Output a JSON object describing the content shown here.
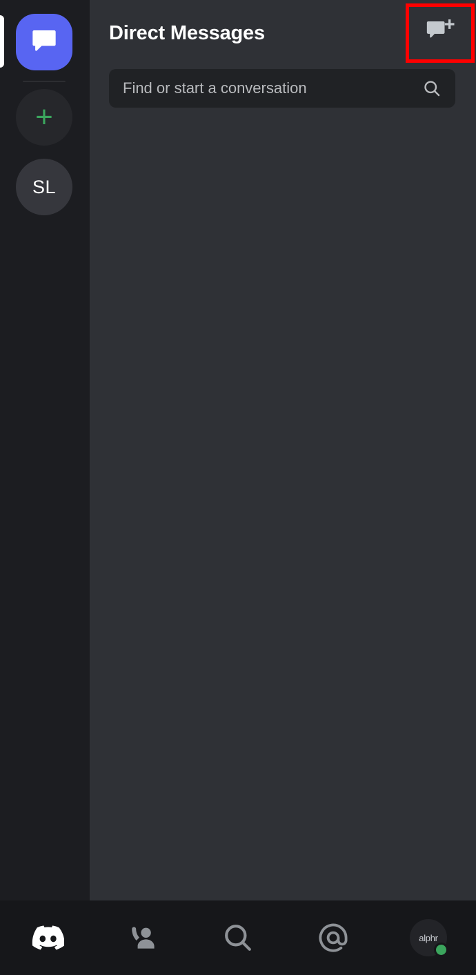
{
  "app": {
    "name": "Discord",
    "platform": "mobile"
  },
  "server_rail": {
    "active_indicator": "white-pill",
    "items": [
      {
        "id": "direct-messages",
        "label": "Direct Messages",
        "icon": "chat-bubble-icon",
        "type": "dm-home",
        "active": true,
        "color": "#5865f2"
      },
      {
        "id": "add-server",
        "label": "+",
        "icon": "plus-icon",
        "type": "add-server",
        "active": false,
        "color": "#3ba55d"
      },
      {
        "id": "server-sl",
        "label": "SL",
        "icon": "server-initials",
        "type": "server",
        "active": false,
        "color": "#36373d"
      }
    ]
  },
  "header": {
    "title": "Direct Messages",
    "new_dm": {
      "label": "New Direct Message",
      "icon": "new-message-icon",
      "highlighted": true,
      "highlight_color": "#ff0000"
    }
  },
  "search": {
    "placeholder": "Find or start a conversation",
    "value": "",
    "icon": "search-icon"
  },
  "dm_list": {
    "items": [],
    "empty": true
  },
  "bottom_nav": {
    "items": [
      {
        "id": "servers",
        "icon": "discord-logo-icon",
        "label": "Servers",
        "active": true
      },
      {
        "id": "friends",
        "icon": "friends-person-icon",
        "label": "Friends",
        "active": false
      },
      {
        "id": "search",
        "icon": "search-icon",
        "label": "Search",
        "active": false
      },
      {
        "id": "mentions",
        "icon": "at-mention-icon",
        "label": "Mentions",
        "active": false
      },
      {
        "id": "profile",
        "icon": "user-avatar",
        "label": "You",
        "active": false
      }
    ],
    "avatar": {
      "label": "alphr",
      "status": "online",
      "status_color": "#3ba55d"
    }
  },
  "colors": {
    "rail_background": "#1c1d21",
    "panel_background": "#2f3136",
    "nav_background": "#16171a",
    "search_background": "#202225",
    "brand_blurple": "#5865f2",
    "online_green": "#3ba55d",
    "highlight_red": "#ff0000",
    "text_primary": "#ffffff",
    "text_muted": "#b9bbbe"
  }
}
